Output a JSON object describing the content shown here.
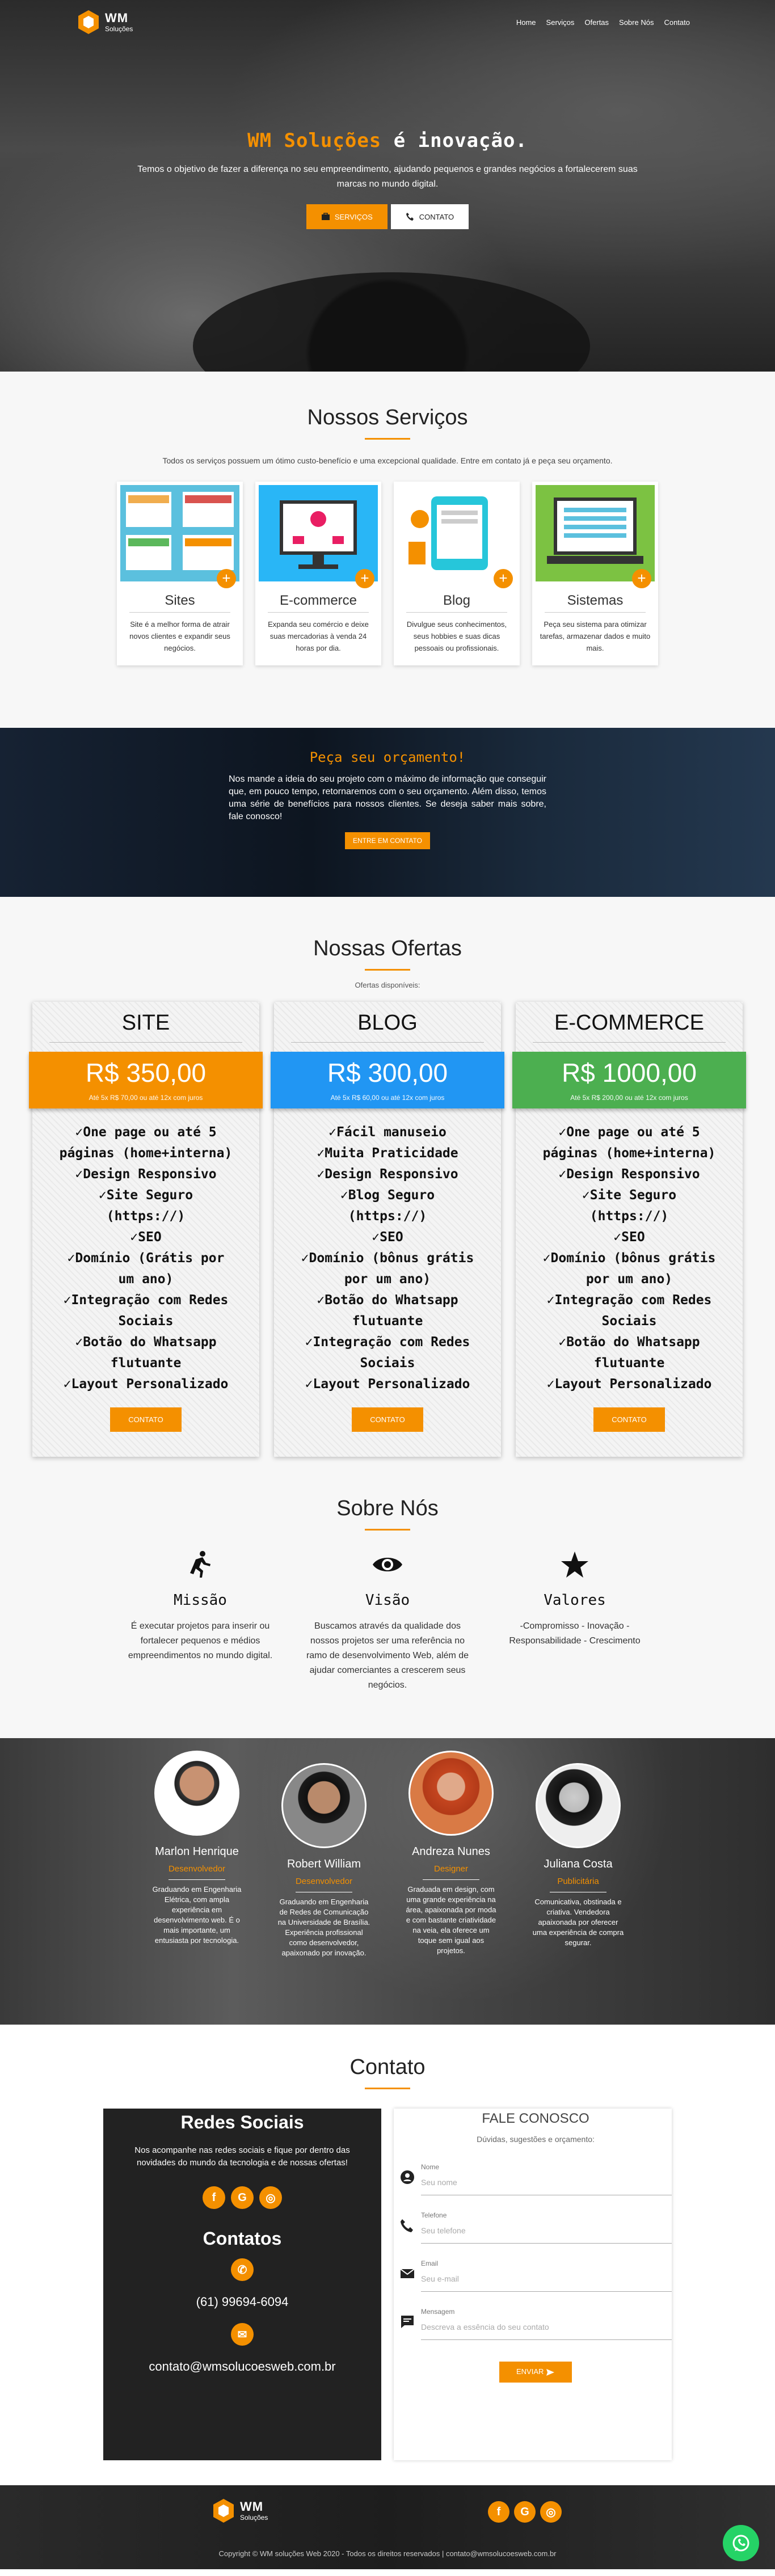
{
  "brand": {
    "name": "WM",
    "tagline": "Soluções"
  },
  "nav": [
    {
      "label": "Home"
    },
    {
      "label": "Serviços"
    },
    {
      "label": "Ofertas"
    },
    {
      "label": "Sobre Nós"
    },
    {
      "label": "Contato"
    }
  ],
  "hero": {
    "title_brand": "WM Soluções",
    "title_rest": " é inovação.",
    "text": "Temos o objetivo de fazer a diferença no seu empreendimento, ajudando pequenos e grandes negócios a fortalecerem suas marcas no mundo digital.",
    "btn_services": "SERVIÇOS",
    "btn_contact": "CONTATO"
  },
  "services": {
    "title": "Nossos Serviços",
    "subtitle": "Todos os serviços possuem um ótimo custo-benefício e uma excepcional qualidade. Entre em contato já e peça seu orçamento.",
    "items": [
      {
        "title": "Sites",
        "text": "Site é a melhor forma de atrair novos clientes e expandir seus negócios.",
        "color": "#5bc0de"
      },
      {
        "title": "E-commerce",
        "text": "Expanda seu comércio e deixe suas mercadorias à venda 24 horas por dia.",
        "color": "#29b6f6"
      },
      {
        "title": "Blog",
        "text": "Divulgue seus conhecimentos, seus hobbies e suas dicas pessoais ou profissionais.",
        "color": "#ffffff"
      },
      {
        "title": "Sistemas",
        "text": "Peça seu sistema para otimizar tarefas, armazenar dados e muito mais.",
        "color": "#7cc242"
      }
    ]
  },
  "quote": {
    "title": "Peça seu orçamento!",
    "text": "Nos mande a ideia do seu projeto com o máximo de informação que conseguir que, em pouco tempo, retornaremos com o seu orçamento. Além disso, temos uma série de benefícios para nossos clientes. Se deseja saber mais sobre, fale conosco!",
    "button": "ENTRE EM CONTATO"
  },
  "offers": {
    "title": "Nossas Ofertas",
    "subtitle": "Ofertas disponíveis:",
    "plans": [
      {
        "name": "SITE",
        "price": "R$ 350,00",
        "installments": "Até 5x R$ 70,00 ou até 12x com juros",
        "color": "#f49000",
        "features": [
          "One page ou até 5 páginas (home+interna)",
          "Design Responsivo",
          "Site Seguro (https://)",
          "SEO",
          "Domínio (Grátis por um ano)",
          "Integração com Redes Sociais",
          "Botão do Whatsapp flutuante",
          "Layout Personalizado"
        ],
        "button": "CONTATO"
      },
      {
        "name": "BLOG",
        "price": "R$ 300,00",
        "installments": "Até 5x R$ 60,00 ou até 12x com juros",
        "color": "#2196f3",
        "features": [
          "Fácil manuseio",
          "Muita Praticidade",
          "Design Responsivo",
          "Blog Seguro (https://)",
          "SEO",
          "Domínio (bônus grátis por um ano)",
          "Botão do Whatsapp flutuante",
          "Integração com Redes Sociais",
          "Layout Personalizado"
        ],
        "button": "CONTATO"
      },
      {
        "name": "E-COMMERCE",
        "price": "R$ 1000,00",
        "installments": "Até 5x R$ 200,00 ou até 12x com juros",
        "color": "#4caf50",
        "features": [
          "One page ou até 5 páginas (home+interna)",
          "Design Responsivo",
          "Site Seguro (https://)",
          "SEO",
          "Domínio (bônus grátis por um ano)",
          "Integração com Redes Sociais",
          "Botão do Whatsapp flutuante",
          "Layout Personalizado"
        ],
        "button": "CONTATO"
      }
    ]
  },
  "about": {
    "title": "Sobre Nós",
    "items": [
      {
        "title": "Missão",
        "icon": "running-person-icon",
        "text": "É executar projetos para inserir ou fortalecer pequenos e médios empreendimentos no mundo digital."
      },
      {
        "title": "Visão",
        "icon": "eye-icon",
        "text": "Buscamos através da qualidade dos nossos projetos ser uma referência no ramo de desenvolvimento Web, além de ajudar comerciantes a crescerem seus negócios."
      },
      {
        "title": "Valores",
        "icon": "star-icon",
        "text": "-Compromisso - Inovação - Responsabilidade - Crescimento"
      }
    ]
  },
  "team": [
    {
      "name": "Marlon Henrique",
      "role": "Desenvolvedor",
      "bio": "Graduando em Engenharia Elétrica, com ampla experiência em desenvolvimento web. É o mais importante, um entusiasta por tecnologia."
    },
    {
      "name": "Robert William",
      "role": "Desenvolvedor",
      "bio": "Graduando em Engenharia de Redes de Comunicação na Universidade de Brasília. Experiência profissional como desenvolvedor, apaixonado por inovação."
    },
    {
      "name": "Andreza Nunes",
      "role": "Designer",
      "bio": "Graduada em design, com uma grande experiência na área, apaixonada por moda e com bastante criatividade na veia, ela oferece um toque sem igual aos projetos."
    },
    {
      "name": "Juliana Costa",
      "role": "Publicitária",
      "bio": "Comunicativa, obstinada e criativa. Vendedora apaixonada por oferecer uma experiência de compra segurar."
    }
  ],
  "contact": {
    "title": "Contato",
    "social_title": "Redes Sociais",
    "social_text": "Nos acompanhe nas redes sociais e fique por dentro das novidades do mundo da tecnologia e de nossas ofertas!",
    "contacts_title": "Contatos",
    "phone": "(61) 99694-6094",
    "email": "contato@wmsolucoesweb.com.br",
    "form_title": "FALE CONOSCO",
    "form_sub": "Dúvidas, sugestões e orçamento:",
    "fields": [
      {
        "label": "Nome",
        "placeholder": "Seu nome"
      },
      {
        "label": "Telefone",
        "placeholder": "Seu telefone"
      },
      {
        "label": "Email",
        "placeholder": "Seu e-mail"
      },
      {
        "label": "Mensagem",
        "placeholder": "Descreva a essência do seu contato"
      }
    ],
    "send": "ENVIAR"
  },
  "footer": {
    "copyright": "Copyright © WM soluções Web 2020 - Todos os direitos reservados | contato@wmsolucoesweb.com.br"
  },
  "colors": {
    "accent": "#f49000",
    "whatsapp": "#25d366"
  }
}
